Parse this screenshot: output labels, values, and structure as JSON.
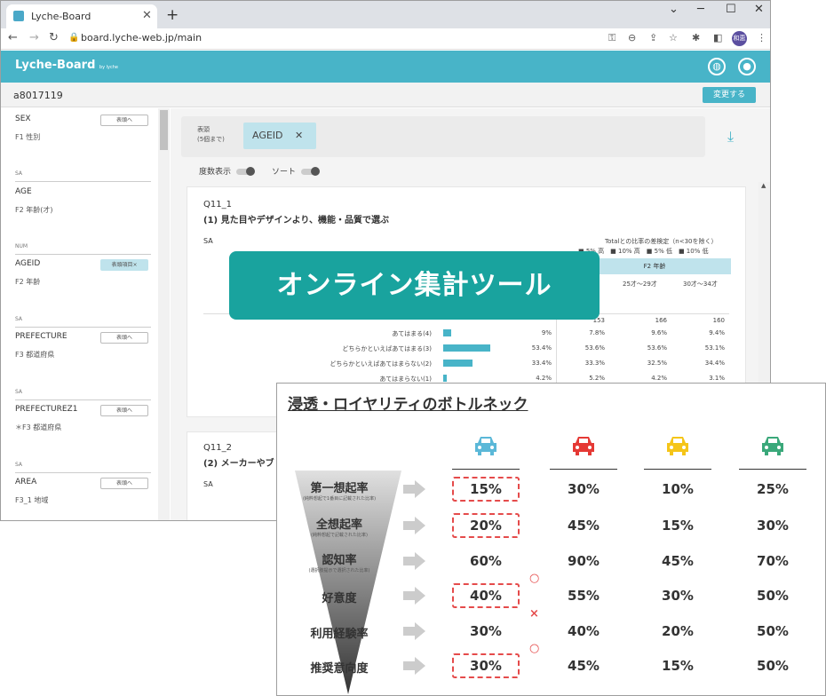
{
  "browser": {
    "tab_title": "Lyche-Board",
    "tab_close": "✕",
    "new_tab": "+",
    "url": "board.lyche-web.jp/main",
    "avatar_text": "和恵"
  },
  "app": {
    "logo": "Lyche-Board",
    "logo_sub": "by lyche",
    "user_id": "a8017119",
    "change_button": "変更する"
  },
  "sidebar": {
    "items": [
      {
        "type": "",
        "title": "SEX",
        "desc": "F1 性別",
        "button": "表頭へ",
        "active": false
      },
      {
        "type": "SA",
        "title": "AGE",
        "desc": "F2 年齢(才)",
        "button": "",
        "active": false
      },
      {
        "type": "NUM",
        "title": "AGEID",
        "desc": "F2 年齢",
        "button": "表頭項目×",
        "active": true
      },
      {
        "type": "SA",
        "title": "PREFECTURE",
        "desc": "F3 都道府県",
        "button": "表頭へ",
        "active": false
      },
      {
        "type": "SA",
        "title": "PREFECTUREZ1",
        "desc": "＊F3 都道府県",
        "button": "表頭へ",
        "active": false
      },
      {
        "type": "SA",
        "title": "AREA",
        "desc": "F3_1 地域",
        "button": "表頭へ",
        "active": false
      }
    ]
  },
  "main": {
    "header_label_line1": "表頭",
    "header_label_line2": "(5個まで)",
    "header_chip": "AGEID",
    "chip_close": "✕",
    "toggle_count": "度数表示",
    "toggle_sort": "ソート",
    "card1": {
      "qid": "Q11_1",
      "question": "(1) 見た目やデザインより、機能・品質で選ぶ",
      "sa": "SA",
      "legend_line1": "Totalとの比率の差検定（n<30を除く）",
      "legend_line2": "■ 5% 高　■ 10% 高　■ 5% 低　■ 10% 低",
      "col_group": "F2 年齢",
      "col_headers": [
        "25才～29才",
        "30才～34才"
      ],
      "n_row": [
        "153",
        "166",
        "160"
      ],
      "rows": [
        {
          "label": "あてはまる(4)",
          "total": "9%",
          "bar": 0.09,
          "c1": "7.8%",
          "c2": "9.6%",
          "c3": "9.4%"
        },
        {
          "label": "どちらかといえばあてはまる(3)",
          "total": "53.4%",
          "bar": 0.534,
          "c1": "53.6%",
          "c2": "53.6%",
          "c3": "53.1%"
        },
        {
          "label": "どちらかといえばあてはまらない(2)",
          "total": "33.4%",
          "bar": 0.334,
          "c1": "33.3%",
          "c2": "32.5%",
          "c3": "34.4%"
        },
        {
          "label": "あてはまらない(1)",
          "total": "4.2%",
          "bar": 0.042,
          "c1": "5.2%",
          "c2": "4.2%",
          "c3": "3.1%"
        }
      ]
    },
    "card2": {
      "qid": "Q11_2",
      "question": "(2) メーカーやブ",
      "sa": "SA"
    }
  },
  "banner": "オンライン集計ツール",
  "bottleneck": {
    "title": "浸透・ロイヤリティのボトルネック",
    "car_colors": [
      "#5bb8d8",
      "#e53935",
      "#f5c518",
      "#3aa87a"
    ],
    "metrics": [
      {
        "label": "第一想起率",
        "sub": "(純粋想起で1番目に記載された比率)",
        "values": [
          "15%",
          "30%",
          "10%",
          "25%"
        ]
      },
      {
        "label": "全想起率",
        "sub": "(純粋想起で記載された比率)",
        "values": [
          "20%",
          "45%",
          "15%",
          "30%"
        ]
      },
      {
        "label": "認知率",
        "sub": "(選択肢提示で選択された比率)",
        "values": [
          "60%",
          "90%",
          "45%",
          "70%"
        ]
      },
      {
        "label": "好意度",
        "sub": "",
        "values": [
          "40%",
          "55%",
          "30%",
          "50%"
        ]
      },
      {
        "label": "利用経験率",
        "sub": "",
        "values": [
          "30%",
          "40%",
          "20%",
          "50%"
        ]
      },
      {
        "label": "推奨意向度",
        "sub": "",
        "values": [
          "30%",
          "45%",
          "15%",
          "50%"
        ]
      }
    ],
    "marks": [
      "○",
      "×",
      "○"
    ]
  }
}
